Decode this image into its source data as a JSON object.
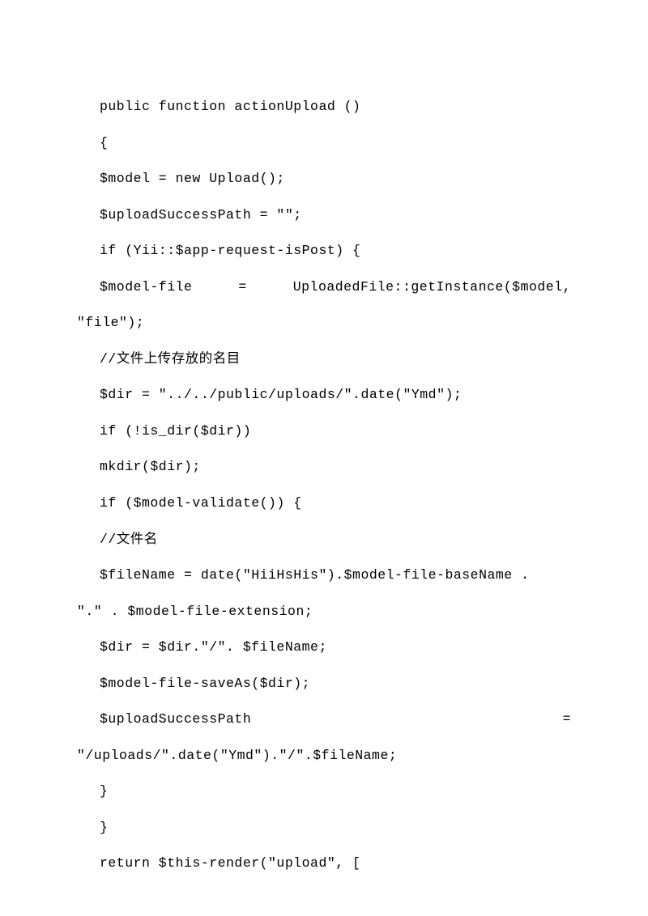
{
  "code": {
    "line1": "public function actionUpload ()",
    "line2": "{",
    "line3": "$model = new Upload();",
    "line4": "$uploadSuccessPath = \"\";",
    "line5": "if (Yii::$app-request-isPost) {",
    "line6a": "$model-file",
    "line6b": "=",
    "line6c": "UploadedFile::getInstance($model,",
    "line7": "\"file\");",
    "line8": "//文件上传存放的名目",
    "line9": "$dir = \"../../public/uploads/\".date(\"Ymd\");",
    "line10": "if (!is_dir($dir))",
    "line11": "mkdir($dir);",
    "line12": "if ($model-validate()) {",
    "line13": "//文件名",
    "line14": "$fileName = date(\"HiiHsHis\").$model-file-baseName .",
    "line15": "\".\" . $model-file-extension;",
    "line16": "$dir = $dir.\"/\". $fileName;",
    "line17": "$model-file-saveAs($dir);",
    "line18a": "$uploadSuccessPath",
    "line18b": "=",
    "line19": "\"/uploads/\".date(\"Ymd\").\"/\".$fileName;",
    "line20": "}",
    "line21": "}",
    "line22": "return $this-render(\"upload\", ["
  }
}
